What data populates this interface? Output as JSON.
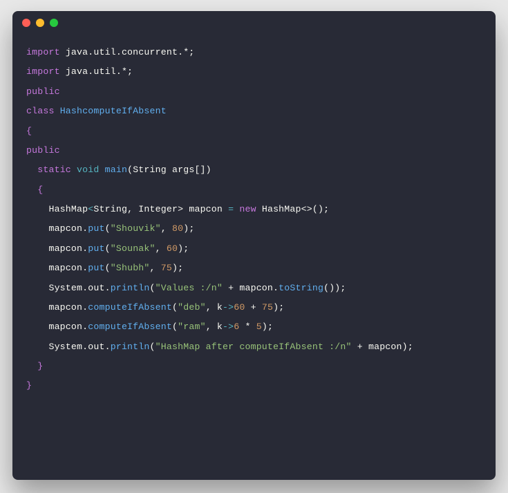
{
  "window": {
    "traffic_lights": [
      "close",
      "minimize",
      "zoom"
    ]
  },
  "code": {
    "lines": {
      "l1_import": "import",
      "l1_rest": " java.util.concurrent.*;",
      "l2_import": "import",
      "l2_rest": " java.util.*;",
      "l3_public": "public",
      "l4_class": "class ",
      "l4_name": "HashcomputeIfAbsent",
      "l5_brace": "{",
      "l6_public": "public",
      "l7_static": "static",
      "l7_void": " void ",
      "l7_main": "main",
      "l7_args": "(String args[])",
      "l8_brace": "  {",
      "l9a": "    HashMap",
      "l9b": "<",
      "l9c": "String, Integer",
      "l9d": "> mapcon ",
      "l9e": "=",
      "l9f": " new ",
      "l9g": "HashMap",
      "l9h": "<>();",
      "l10a": "    mapcon.",
      "l10b": "put",
      "l10c": "(",
      "l10d": "\"Shouvik\"",
      "l10e": ", ",
      "l10f": "80",
      "l10g": ");",
      "l11a": "    mapcon.",
      "l11b": "put",
      "l11c": "(",
      "l11d": "\"Sounak\"",
      "l11e": ", ",
      "l11f": "60",
      "l11g": ");",
      "l12a": "    mapcon.",
      "l12b": "put",
      "l12c": "(",
      "l12d": "\"Shubh\"",
      "l12e": ", ",
      "l12f": "75",
      "l12g": ");",
      "l13a": "    System.out.",
      "l13b": "println",
      "l13c": "(",
      "l13d": "\"Values :/n\"",
      "l13e": " + mapcon.",
      "l13f": "toString",
      "l13g": "());",
      "l14a": "    mapcon.",
      "l14b": "computeIfAbsent",
      "l14c": "(",
      "l14d": "\"deb\"",
      "l14e": ", k",
      "l14f": "->",
      "l14g": "60",
      "l14h": " + ",
      "l14i": "75",
      "l14j": ");",
      "l15a": "    mapcon.",
      "l15b": "computeIfAbsent",
      "l15c": "(",
      "l15d": "\"ram\"",
      "l15e": ", k",
      "l15f": "->",
      "l15g": "6",
      "l15h": " * ",
      "l15i": "5",
      "l15j": ");",
      "l16a": "    System.out.",
      "l16b": "println",
      "l16c": "(",
      "l16d": "\"HashMap after computeIfAbsent :/n\"",
      "l16e": " + mapcon);",
      "l17": "  }",
      "l18": "}"
    }
  }
}
